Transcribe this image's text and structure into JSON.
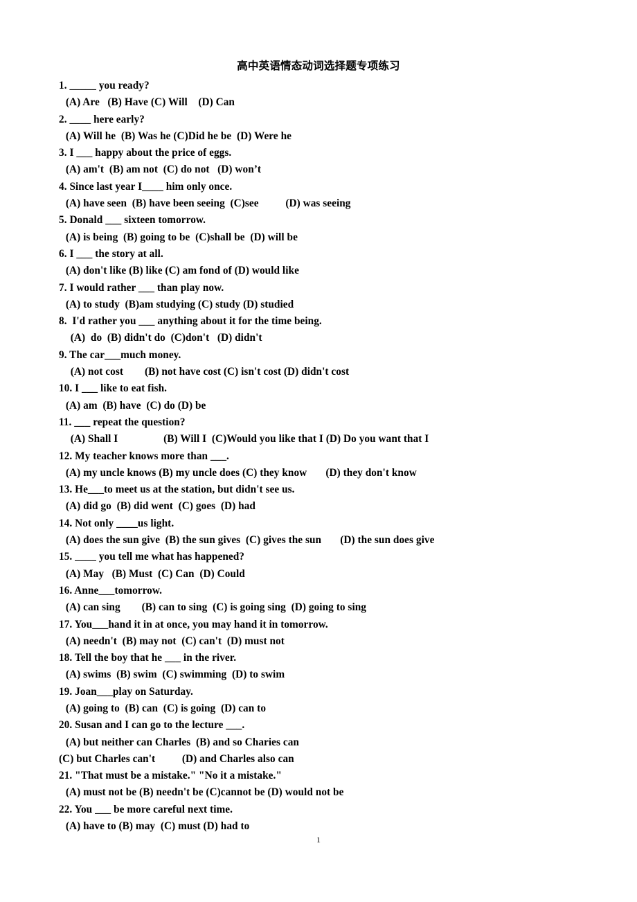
{
  "document": {
    "title": "高中英语情态动词选择题专项练习",
    "page_number": "1",
    "lines": [
      {
        "id": "q1",
        "kind": "question",
        "text": "1. _____ you ready?"
      },
      {
        "id": "q1opt",
        "kind": "options",
        "text": " (A) Are   (B) Have (C) Will    (D) Can"
      },
      {
        "id": "q2",
        "kind": "question",
        "text": "2. ____ here early?"
      },
      {
        "id": "q2opt",
        "kind": "options",
        "text": " (A) Will he  (B) Was he (C)Did he be  (D) Were he"
      },
      {
        "id": "q3",
        "kind": "question",
        "text": "3. I ___ happy about the price of eggs."
      },
      {
        "id": "q3opt",
        "kind": "options",
        "text": " (A) am't  (B) am not  (C) do not   (D) won’t"
      },
      {
        "id": "q4",
        "kind": "question",
        "text": "4. Since last year I____ him only once."
      },
      {
        "id": "q4opt",
        "kind": "options",
        "text": " (A) have seen  (B) have been seeing  (C)see          (D) was seeing"
      },
      {
        "id": "q5",
        "kind": "question",
        "text": "5. Donald ___ sixteen tomorrow."
      },
      {
        "id": "q5opt",
        "kind": "options",
        "text": " (A) is being  (B) going to be  (C)shall be  (D) will be"
      },
      {
        "id": "q6",
        "kind": "question",
        "text": "6. I ___ the story at all."
      },
      {
        "id": "q6opt",
        "kind": "options",
        "text": " (A) don't like (B) like (C) am fond of (D) would like"
      },
      {
        "id": "q7",
        "kind": "question",
        "text": "7. I would rather ___ than play now."
      },
      {
        "id": "q7opt",
        "kind": "options",
        "text": " (A) to study  (B)am studying (C) study (D) studied"
      },
      {
        "id": "q8",
        "kind": "question",
        "text": "8.  I'd rather you ___ anything about it for the time being."
      },
      {
        "id": "q8opt",
        "kind": "options",
        "text": "  (A)  do  (B) didn't do  (C)don't   (D) didn't"
      },
      {
        "id": "q9",
        "kind": "question",
        "text": "9. The car___much money."
      },
      {
        "id": "q9opt",
        "kind": "options",
        "text": "  (A) not cost        (B) not have cost (C) isn't cost (D) didn't cost"
      },
      {
        "id": "q10",
        "kind": "question",
        "text": "10. I ___ like to eat fish."
      },
      {
        "id": "q10opt",
        "kind": "options",
        "text": " (A) am  (B) have  (C) do (D) be"
      },
      {
        "id": "q11",
        "kind": "question",
        "text": "11. ___ repeat the question?"
      },
      {
        "id": "q11opt",
        "kind": "options",
        "text": "  (A) Shall I                 (B) Will I  (C)Would you like that I (D) Do you want that I"
      },
      {
        "id": "q12",
        "kind": "question",
        "text": "12. My teacher knows more than ___."
      },
      {
        "id": "q12opt",
        "kind": "options",
        "text": " (A) my uncle knows (B) my uncle does (C) they know       (D) they don't know"
      },
      {
        "id": "q13",
        "kind": "question",
        "text": "13. He___to meet us at the station, but didn't see us."
      },
      {
        "id": "q13opt",
        "kind": "options",
        "text": " (A) did go  (B) did went  (C) goes  (D) had"
      },
      {
        "id": "q14",
        "kind": "question",
        "text": "14. Not only ____us light."
      },
      {
        "id": "q14opt",
        "kind": "options",
        "text": " (A) does the sun give  (B) the sun gives  (C) gives the sun       (D) the sun does give"
      },
      {
        "id": "q15",
        "kind": "question",
        "text": "15. ____ you tell me what has happened?"
      },
      {
        "id": "q15opt",
        "kind": "options",
        "text": " (A) May   (B) Must  (C) Can  (D) Could"
      },
      {
        "id": "q16",
        "kind": "question",
        "text": "16. Anne___tomorrow."
      },
      {
        "id": "q16opt",
        "kind": "options",
        "text": " (A) can sing        (B) can to sing  (C) is going sing  (D) going to sing"
      },
      {
        "id": "q17",
        "kind": "question",
        "text": "17. You___hand it in at once, you may hand it in tomorrow."
      },
      {
        "id": "q17opt",
        "kind": "options",
        "text": " (A) needn't  (B) may not  (C) can't  (D) must not"
      },
      {
        "id": "q18",
        "kind": "question",
        "text": "18. Tell the boy that he ___ in the river."
      },
      {
        "id": "q18opt",
        "kind": "options",
        "text": " (A) swims  (B) swim  (C) swimming  (D) to swim"
      },
      {
        "id": "q19",
        "kind": "question",
        "text": "19. Joan___play on Saturday."
      },
      {
        "id": "q19opt",
        "kind": "options",
        "text": " (A) going to  (B) can  (C) is going  (D) can to"
      },
      {
        "id": "q20",
        "kind": "question",
        "text": "20. Susan and I can go to the lecture ___."
      },
      {
        "id": "q20optA",
        "kind": "options",
        "text": " (A) but neither can Charles  (B) and so Charies can"
      },
      {
        "id": "q20optB",
        "kind": "options-2",
        "text": "(C) but Charles can't          (D) and Charles also can"
      },
      {
        "id": "q21",
        "kind": "question",
        "text": "21. \"That must be a mistake.\" \"No it a mistake.\""
      },
      {
        "id": "q21opt",
        "kind": "options",
        "text": " (A) must not be (B) needn't be (C)cannot be (D) would not be"
      },
      {
        "id": "q22",
        "kind": "question",
        "text": "22. You ___ be more careful next time."
      },
      {
        "id": "q22opt",
        "kind": "options",
        "text": " (A) have to (B) may  (C) must (D) had to"
      }
    ]
  }
}
